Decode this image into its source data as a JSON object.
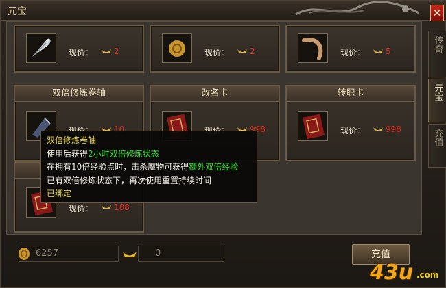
{
  "window": {
    "title": "元宝",
    "close_label": "✕"
  },
  "price_label": "现价：",
  "cards": [
    {
      "title": "",
      "price": "2",
      "icon": "feather-icon"
    },
    {
      "title": "",
      "price": "2",
      "icon": "bead-icon"
    },
    {
      "title": "",
      "price": "5",
      "icon": "horn-icon"
    },
    {
      "title": "双倍修炼卷轴",
      "price": "10",
      "icon": "scroll-icon"
    },
    {
      "title": "改名卡",
      "price": "998",
      "icon": "book-icon"
    },
    {
      "title": "转职卡",
      "price": "998",
      "icon": "book-icon"
    },
    {
      "title": "",
      "price": "188",
      "icon": "book-icon"
    }
  ],
  "tabs": [
    {
      "label": "传奇",
      "active": false
    },
    {
      "label": "元宝",
      "active": true
    },
    {
      "label": "充值",
      "active": false
    }
  ],
  "currency": {
    "gold_value": "6257",
    "yuanbao_value": "0"
  },
  "recharge_button": "充值",
  "tooltip": {
    "title": "双倍修炼卷轴",
    "line1_a": "使用后获得",
    "line1_b": "2小时双倍修炼状态",
    "line2_a": "在拥有10倍经验点时，击杀魔物可获得",
    "line2_b": "额外双倍经验",
    "line3": "已有双倍修炼状态下，再次使用重置持续时间",
    "line4": "已绑定"
  },
  "watermark": {
    "text": "43u",
    "domain": ".com"
  },
  "colors": {
    "price_red": "#e02a1c",
    "tooltip_yellow": "#e8d53a",
    "tooltip_green": "#3fe83a",
    "close_red": "#c82418"
  }
}
